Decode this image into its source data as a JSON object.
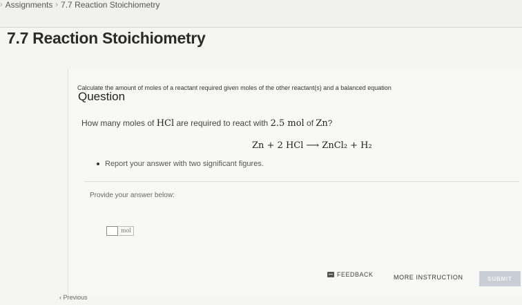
{
  "breadcrumb": {
    "items": [
      "Assignments",
      "7.7 Reaction Stoichiometry"
    ]
  },
  "page": {
    "title": "7.7 Reaction Stoichiometry"
  },
  "question": {
    "instructions": "Calculate the amount of moles of a reactant required given moles of the other reactant(s) and a balanced equation",
    "heading": "Question",
    "text_prefix": "How many moles of ",
    "text_hcl": "HCl",
    "text_mid": " are required to react with ",
    "text_amount": "2.5 mol",
    "text_of": " of ",
    "text_zn": "Zn",
    "text_end": "?",
    "equation": "Zn + 2 HCl ⟶ ZnCl₂ + H₂",
    "bullet": "Report your answer with two significant figures."
  },
  "answer": {
    "prompt": "Provide your answer below:",
    "value": "",
    "unit": "mol"
  },
  "actions": {
    "feedback_label": "FEEDBACK",
    "more_label": "MORE INSTRUCTION",
    "submit_label": "SUBMIT",
    "previous_label": "‹ Previous"
  }
}
